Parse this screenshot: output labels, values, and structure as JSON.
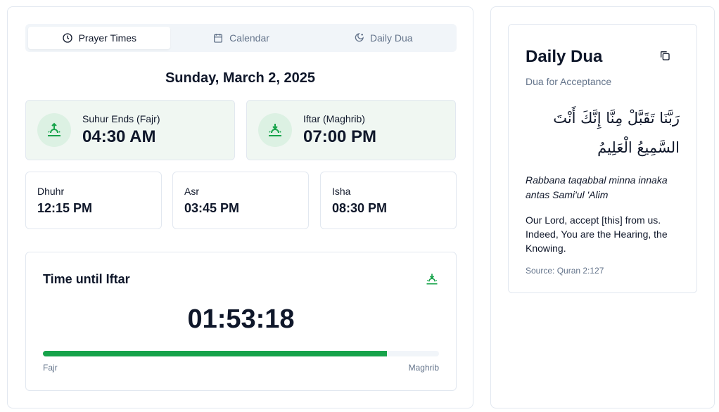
{
  "tabs": [
    {
      "label": "Prayer Times",
      "icon": "clock-icon"
    },
    {
      "label": "Calendar",
      "icon": "calendar-icon"
    },
    {
      "label": "Daily Dua",
      "icon": "moon-icon"
    }
  ],
  "date": "Sunday, March 2, 2025",
  "suhur": {
    "label": "Suhur Ends (Fajr)",
    "time": "04:30 AM"
  },
  "iftar": {
    "label": "Iftar (Maghrib)",
    "time": "07:00 PM"
  },
  "prayers": [
    {
      "name": "Dhuhr",
      "time": "12:15 PM"
    },
    {
      "name": "Asr",
      "time": "03:45 PM"
    },
    {
      "name": "Isha",
      "time": "08:30 PM"
    }
  ],
  "countdown": {
    "title": "Time until Iftar",
    "timer": "01:53:18",
    "progress": 0.869,
    "start_label": "Fajr",
    "end_label": "Maghrib"
  },
  "dua": {
    "title": "Daily Dua",
    "subtitle": "Dua for Acceptance",
    "arabic": "رَبَّنَا تَقَبَّلْ مِنَّا إِنَّكَ أَنْتَ السَّمِيعُ الْعَلِيمُ",
    "transliteration": "Rabbana taqabbal minna innaka antas Sami'ul 'Alim",
    "translation": "Our Lord, accept [this] from us. Indeed, You are the Hearing, the Knowing.",
    "source": "Source: Quran 2:127"
  },
  "colors": {
    "accent": "#16a34a"
  }
}
